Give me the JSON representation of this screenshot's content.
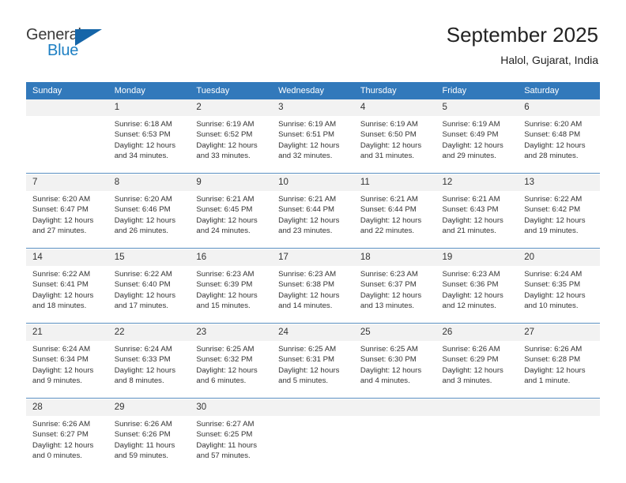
{
  "brand": {
    "name_top": "General",
    "name_bottom": "Blue",
    "color_top": "#3a3a3a",
    "color_bottom": "#1d7fc3",
    "triangle_color": "#1565a8"
  },
  "header": {
    "title": "September 2025",
    "subtitle": "Halol, Gujarat, India"
  },
  "theme": {
    "header_bg": "#3279bb",
    "header_text": "#ffffff",
    "date_cell_bg": "#f2f2f2",
    "separator": "#5a8fc0",
    "body_text": "#333333"
  },
  "weekday_headers": [
    "Sunday",
    "Monday",
    "Tuesday",
    "Wednesday",
    "Thursday",
    "Friday",
    "Saturday"
  ],
  "weeks": [
    {
      "days": [
        {
          "date": "",
          "lines": [
            "",
            "",
            "",
            ""
          ]
        },
        {
          "date": "1",
          "lines": [
            "Sunrise: 6:18 AM",
            "Sunset: 6:53 PM",
            "Daylight: 12 hours",
            "and 34 minutes."
          ]
        },
        {
          "date": "2",
          "lines": [
            "Sunrise: 6:19 AM",
            "Sunset: 6:52 PM",
            "Daylight: 12 hours",
            "and 33 minutes."
          ]
        },
        {
          "date": "3",
          "lines": [
            "Sunrise: 6:19 AM",
            "Sunset: 6:51 PM",
            "Daylight: 12 hours",
            "and 32 minutes."
          ]
        },
        {
          "date": "4",
          "lines": [
            "Sunrise: 6:19 AM",
            "Sunset: 6:50 PM",
            "Daylight: 12 hours",
            "and 31 minutes."
          ]
        },
        {
          "date": "5",
          "lines": [
            "Sunrise: 6:19 AM",
            "Sunset: 6:49 PM",
            "Daylight: 12 hours",
            "and 29 minutes."
          ]
        },
        {
          "date": "6",
          "lines": [
            "Sunrise: 6:20 AM",
            "Sunset: 6:48 PM",
            "Daylight: 12 hours",
            "and 28 minutes."
          ]
        }
      ]
    },
    {
      "days": [
        {
          "date": "7",
          "lines": [
            "Sunrise: 6:20 AM",
            "Sunset: 6:47 PM",
            "Daylight: 12 hours",
            "and 27 minutes."
          ]
        },
        {
          "date": "8",
          "lines": [
            "Sunrise: 6:20 AM",
            "Sunset: 6:46 PM",
            "Daylight: 12 hours",
            "and 26 minutes."
          ]
        },
        {
          "date": "9",
          "lines": [
            "Sunrise: 6:21 AM",
            "Sunset: 6:45 PM",
            "Daylight: 12 hours",
            "and 24 minutes."
          ]
        },
        {
          "date": "10",
          "lines": [
            "Sunrise: 6:21 AM",
            "Sunset: 6:44 PM",
            "Daylight: 12 hours",
            "and 23 minutes."
          ]
        },
        {
          "date": "11",
          "lines": [
            "Sunrise: 6:21 AM",
            "Sunset: 6:44 PM",
            "Daylight: 12 hours",
            "and 22 minutes."
          ]
        },
        {
          "date": "12",
          "lines": [
            "Sunrise: 6:21 AM",
            "Sunset: 6:43 PM",
            "Daylight: 12 hours",
            "and 21 minutes."
          ]
        },
        {
          "date": "13",
          "lines": [
            "Sunrise: 6:22 AM",
            "Sunset: 6:42 PM",
            "Daylight: 12 hours",
            "and 19 minutes."
          ]
        }
      ]
    },
    {
      "days": [
        {
          "date": "14",
          "lines": [
            "Sunrise: 6:22 AM",
            "Sunset: 6:41 PM",
            "Daylight: 12 hours",
            "and 18 minutes."
          ]
        },
        {
          "date": "15",
          "lines": [
            "Sunrise: 6:22 AM",
            "Sunset: 6:40 PM",
            "Daylight: 12 hours",
            "and 17 minutes."
          ]
        },
        {
          "date": "16",
          "lines": [
            "Sunrise: 6:23 AM",
            "Sunset: 6:39 PM",
            "Daylight: 12 hours",
            "and 15 minutes."
          ]
        },
        {
          "date": "17",
          "lines": [
            "Sunrise: 6:23 AM",
            "Sunset: 6:38 PM",
            "Daylight: 12 hours",
            "and 14 minutes."
          ]
        },
        {
          "date": "18",
          "lines": [
            "Sunrise: 6:23 AM",
            "Sunset: 6:37 PM",
            "Daylight: 12 hours",
            "and 13 minutes."
          ]
        },
        {
          "date": "19",
          "lines": [
            "Sunrise: 6:23 AM",
            "Sunset: 6:36 PM",
            "Daylight: 12 hours",
            "and 12 minutes."
          ]
        },
        {
          "date": "20",
          "lines": [
            "Sunrise: 6:24 AM",
            "Sunset: 6:35 PM",
            "Daylight: 12 hours",
            "and 10 minutes."
          ]
        }
      ]
    },
    {
      "days": [
        {
          "date": "21",
          "lines": [
            "Sunrise: 6:24 AM",
            "Sunset: 6:34 PM",
            "Daylight: 12 hours",
            "and 9 minutes."
          ]
        },
        {
          "date": "22",
          "lines": [
            "Sunrise: 6:24 AM",
            "Sunset: 6:33 PM",
            "Daylight: 12 hours",
            "and 8 minutes."
          ]
        },
        {
          "date": "23",
          "lines": [
            "Sunrise: 6:25 AM",
            "Sunset: 6:32 PM",
            "Daylight: 12 hours",
            "and 6 minutes."
          ]
        },
        {
          "date": "24",
          "lines": [
            "Sunrise: 6:25 AM",
            "Sunset: 6:31 PM",
            "Daylight: 12 hours",
            "and 5 minutes."
          ]
        },
        {
          "date": "25",
          "lines": [
            "Sunrise: 6:25 AM",
            "Sunset: 6:30 PM",
            "Daylight: 12 hours",
            "and 4 minutes."
          ]
        },
        {
          "date": "26",
          "lines": [
            "Sunrise: 6:26 AM",
            "Sunset: 6:29 PM",
            "Daylight: 12 hours",
            "and 3 minutes."
          ]
        },
        {
          "date": "27",
          "lines": [
            "Sunrise: 6:26 AM",
            "Sunset: 6:28 PM",
            "Daylight: 12 hours",
            "and 1 minute."
          ]
        }
      ]
    },
    {
      "days": [
        {
          "date": "28",
          "lines": [
            "Sunrise: 6:26 AM",
            "Sunset: 6:27 PM",
            "Daylight: 12 hours",
            "and 0 minutes."
          ]
        },
        {
          "date": "29",
          "lines": [
            "Sunrise: 6:26 AM",
            "Sunset: 6:26 PM",
            "Daylight: 11 hours",
            "and 59 minutes."
          ]
        },
        {
          "date": "30",
          "lines": [
            "Sunrise: 6:27 AM",
            "Sunset: 6:25 PM",
            "Daylight: 11 hours",
            "and 57 minutes."
          ]
        },
        {
          "date": "",
          "lines": [
            "",
            "",
            "",
            ""
          ]
        },
        {
          "date": "",
          "lines": [
            "",
            "",
            "",
            ""
          ]
        },
        {
          "date": "",
          "lines": [
            "",
            "",
            "",
            ""
          ]
        },
        {
          "date": "",
          "lines": [
            "",
            "",
            "",
            ""
          ]
        }
      ]
    }
  ]
}
